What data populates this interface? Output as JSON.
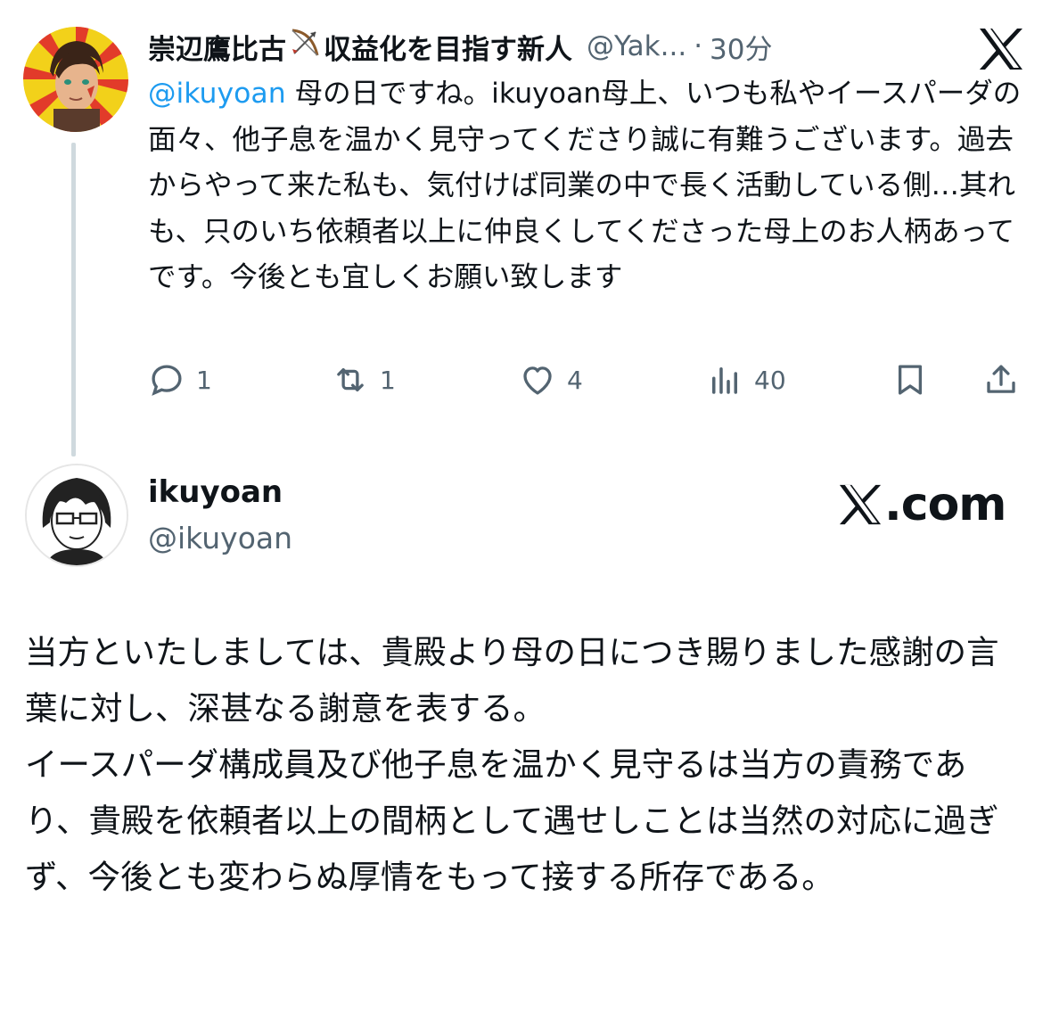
{
  "parent_tweet": {
    "display_name": "崇辺鷹比古",
    "emoji": "🏹",
    "name_suffix": "収益化を目指す新人",
    "handle": "@Yak...",
    "separator": "·",
    "time": "30分",
    "mention": "@ikuyoan",
    "text": "母の日ですね。ikuyoan母上、いつも私やイースパーダの面々、他子息を温かく見守ってくださり誠に有難うございます。過去からやって来た私も、気付けば同業の中で長く活動している側…其れも、只のいち依頼者以上に仲良くしてくださった母上のお人柄あってです。今後とも宜しくお願い致します",
    "actions": {
      "reply_count": "1",
      "retweet_count": "1",
      "like_count": "4",
      "views_count": "40"
    }
  },
  "reply_card": {
    "display_name": "ikuyoan",
    "handle": "@ikuyoan",
    "brand": ".com",
    "paragraph1": "当方といたしましては、貴殿より母の日につき賜りました感謝の言葉に対し、深甚なる謝意を表する。",
    "paragraph2": "イースパーダ構成員及び他子息を温かく見守るは当方の責務であり、貴殿を依頼者以上の間柄として遇せしことは当然の対応に過ぎず、今後とも変わらぬ厚情をもって接する所存である。"
  },
  "colors": {
    "text": "#0f1419",
    "secondary": "#536471",
    "link": "#1d9bf0",
    "thread_line": "#cfd9de"
  },
  "icons": [
    "x-logo-icon",
    "reply-icon",
    "retweet-icon",
    "like-icon",
    "views-icon",
    "bookmark-icon",
    "share-icon"
  ]
}
